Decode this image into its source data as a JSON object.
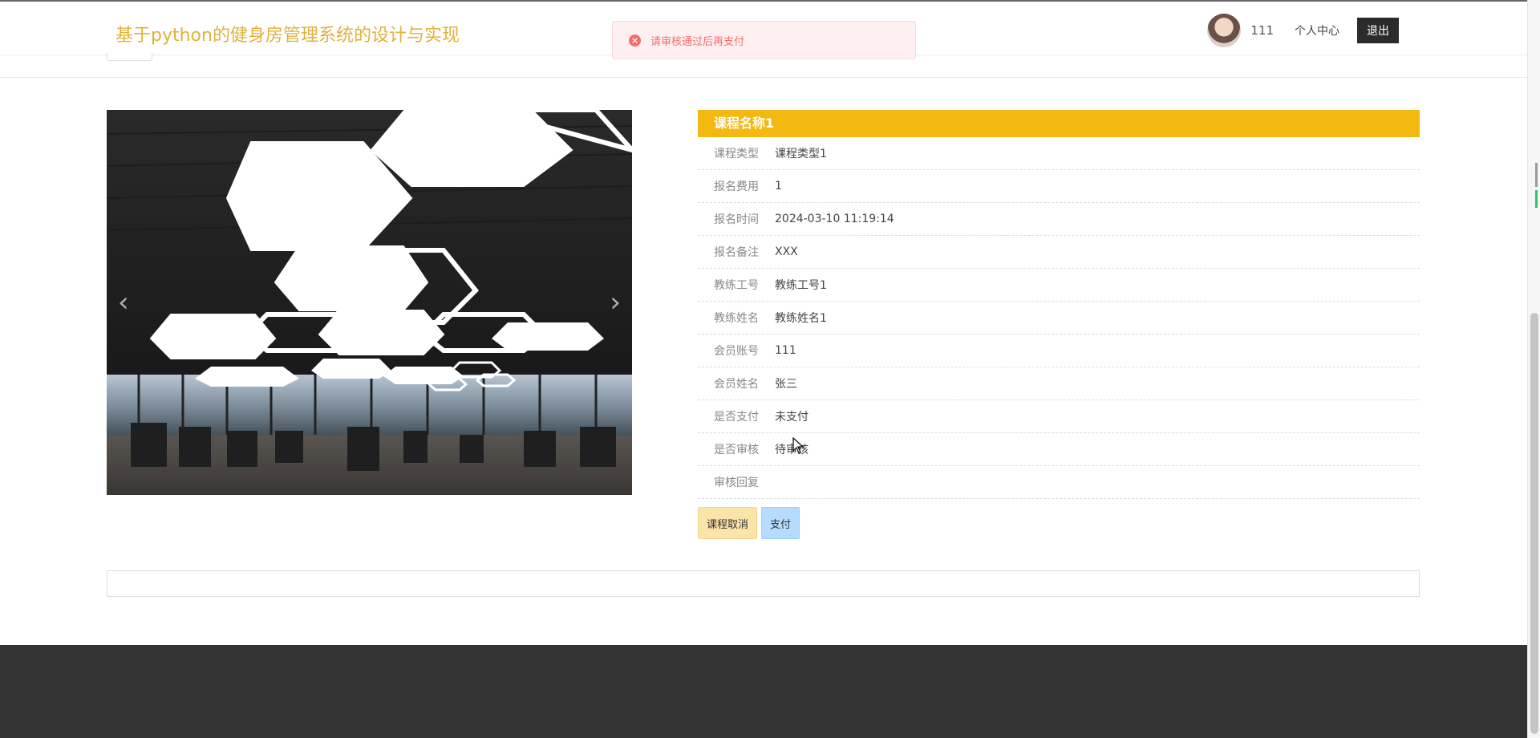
{
  "header": {
    "site_title": "基于python的健身房管理系统的设计与实现",
    "username": "111",
    "user_center": "个人中心",
    "logout": "退出"
  },
  "toast": {
    "message": "请审核通过后再支付",
    "type": "error",
    "icon": "error-circle-icon",
    "color": "#f56c6c"
  },
  "carousel": {
    "image": "gym-interior-hexagon-lights",
    "prev_icon": "chevron-left-icon",
    "next_icon": "chevron-right-icon"
  },
  "detail": {
    "title": "课程名称1",
    "rows": [
      {
        "label": "课程类型",
        "value": "课程类型1"
      },
      {
        "label": "报名费用",
        "value": "1"
      },
      {
        "label": "报名时间",
        "value": "2024-03-10 11:19:14"
      },
      {
        "label": "报名备注",
        "value": "XXX"
      },
      {
        "label": "教练工号",
        "value": "教练工号1"
      },
      {
        "label": "教练姓名",
        "value": "教练姓名1"
      },
      {
        "label": "会员账号",
        "value": "111"
      },
      {
        "label": "会员姓名",
        "value": "张三"
      },
      {
        "label": "是否支付",
        "value": "未支付"
      },
      {
        "label": "是否审核",
        "value": "待审核"
      },
      {
        "label": "审核回复",
        "value": ""
      }
    ],
    "actions": {
      "cancel": "课程取消",
      "pay": "支付"
    }
  },
  "colors": {
    "title_accent": "#e0b23a",
    "detail_header": "#f4b911",
    "cancel_button": "#fbe4a8",
    "pay_button": "#b5dcff",
    "footer": "#333333"
  }
}
